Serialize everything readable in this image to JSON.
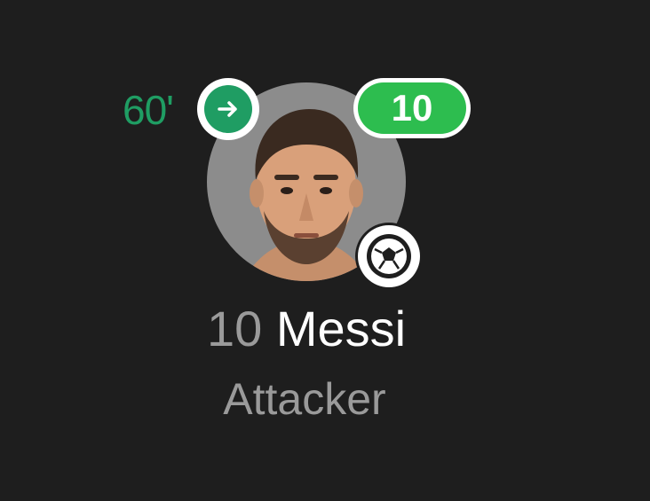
{
  "player": {
    "shirt_number": "10",
    "name": "Messi",
    "position": "Attacker",
    "rating": "10",
    "substitution_minute": "60'"
  },
  "icons": {
    "substitution": "arrow-right-icon",
    "goal": "football-icon"
  },
  "colors": {
    "background": "#1e1e1e",
    "sub_green": "#1f9d63",
    "rating_green": "#2dbd4f",
    "avatar_bg": "#8c8c8c",
    "muted_text": "#9a9a9a",
    "name_text": "#ffffff"
  }
}
